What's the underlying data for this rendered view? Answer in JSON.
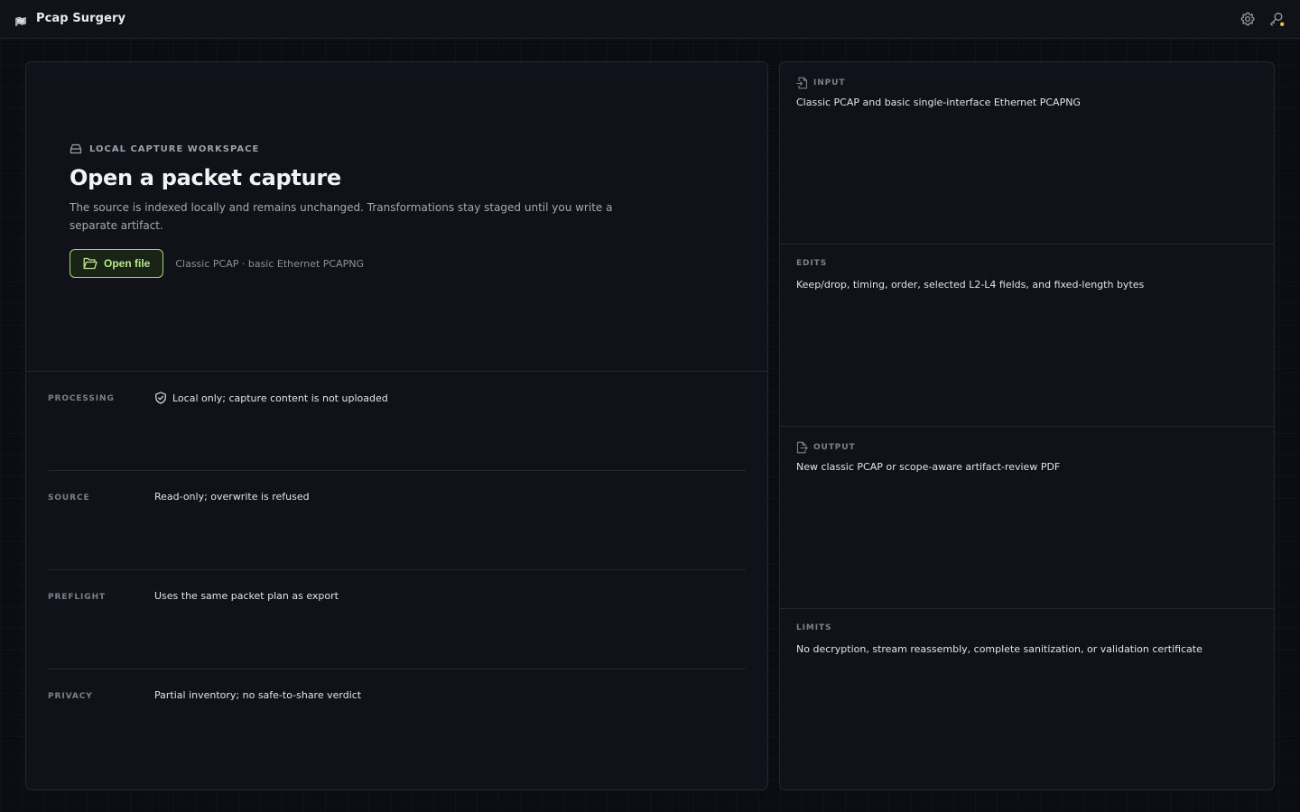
{
  "app": {
    "title": "Pcap Surgery",
    "logo_icon": "flag-wave-logo",
    "settings_icon": "gear-icon",
    "tools_icon": "key-wrench-icon"
  },
  "hero": {
    "eyebrow_icon": "drive-icon",
    "eyebrow": "LOCAL CAPTURE WORKSPACE",
    "title": "Open a packet capture",
    "description": "The source is indexed locally and remains unchanged. Transformations stay staged until you write a separate artifact.",
    "open_button_icon": "folder-open-icon",
    "open_button_label": "Open file",
    "formats_note": "Classic PCAP · basic Ethernet PCAPNG"
  },
  "facts": [
    {
      "label": "PROCESSING",
      "value": "Local only; capture content is not uploaded",
      "icon": "shield-check-icon"
    },
    {
      "label": "SOURCE",
      "value": "Read-only; overwrite is refused"
    },
    {
      "label": "PREFLIGHT",
      "value": "Uses the same packet plan as export"
    },
    {
      "label": "PRIVACY",
      "value": "Partial inventory; no safe-to-share verdict"
    }
  ],
  "specs": [
    {
      "label": "INPUT",
      "value": "Classic PCAP and basic single-interface Ethernet PCAPNG",
      "icon": "file-import-icon"
    },
    {
      "label": "EDITS",
      "value": "Keep/drop, timing, order, selected L2-L4 fields, and fixed-length bytes"
    },
    {
      "label": "OUTPUT",
      "value": "New classic PCAP or scope-aware artifact-review PDF",
      "icon": "file-export-icon"
    },
    {
      "label": "LIMITS",
      "value": "No decryption, stream reassembly, complete sanitization, or validation certificate"
    }
  ],
  "colors": {
    "background": "#0c0d12",
    "panel": "#111219",
    "border": "#262831",
    "accent_green": "#a2d47a",
    "accent_green_text": "#b7e58f"
  }
}
